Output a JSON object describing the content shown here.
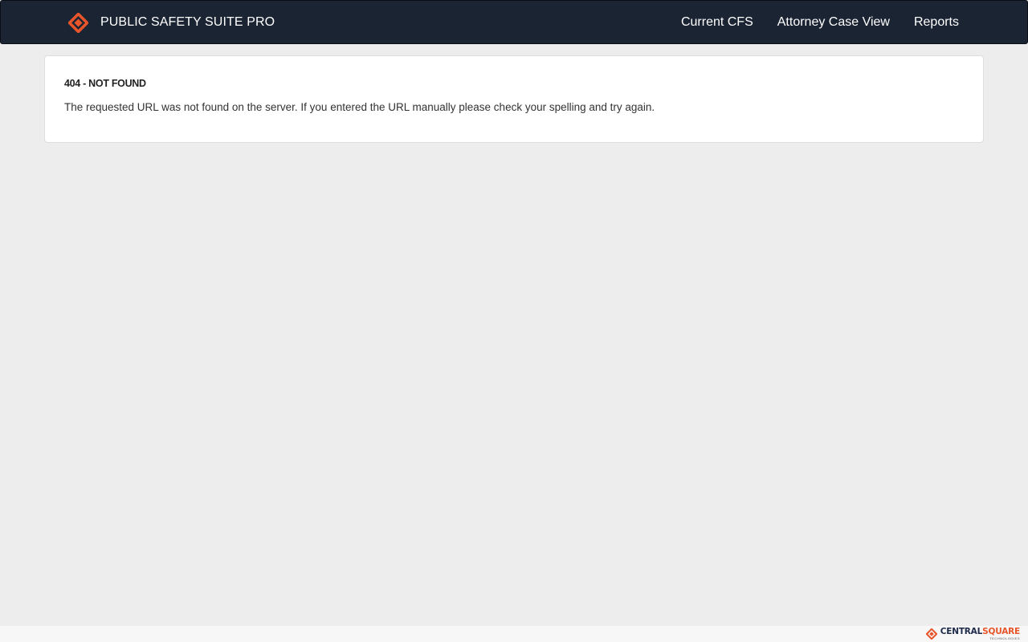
{
  "navbar": {
    "brand": {
      "icon": "centralsquare-logo-icon",
      "title": "PUBLIC SAFETY SUITE PRO"
    },
    "links": [
      {
        "label": "Current CFS"
      },
      {
        "label": "Attorney Case View"
      },
      {
        "label": "Reports"
      }
    ]
  },
  "error": {
    "title": "404 - NOT FOUND",
    "message": "The requested URL was not found on the server. If you entered the URL manually please check your spelling and try again."
  },
  "footer": {
    "logo": {
      "icon": "centralsquare-logo-icon",
      "brand_part_a": "CENTRAL",
      "brand_part_b": "SQUARE",
      "subtitle": "TECHNOLOGIES"
    }
  },
  "colors": {
    "navbar_bg": "#1b2433",
    "page_bg": "#ededed",
    "panel_bg": "#ffffff",
    "accent_orange": "#e8552a",
    "brand_navy": "#1e2a4a"
  }
}
